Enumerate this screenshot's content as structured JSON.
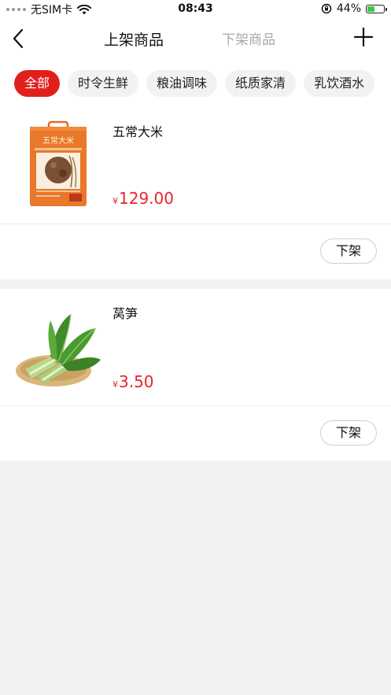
{
  "status_bar": {
    "carrier": "无SIM卡",
    "time": "08:43",
    "battery_text": "44%",
    "battery_level": 0.44,
    "battery_color": "#3cc94a"
  },
  "nav": {
    "tab_active": "上架商品",
    "tab_inactive": "下架商品"
  },
  "categories": [
    "全部",
    "时令生鲜",
    "粮油调味",
    "纸质家清",
    "乳饮酒水"
  ],
  "accent_color": "#e1201b",
  "price_color": "#e8242b",
  "products": [
    {
      "name": "五常大米",
      "currency": "¥",
      "price": "129.00",
      "package_text": "五常大米",
      "action_label": "下架"
    },
    {
      "name": "莴笋",
      "currency": "¥",
      "price": "3.50",
      "action_label": "下架"
    }
  ]
}
